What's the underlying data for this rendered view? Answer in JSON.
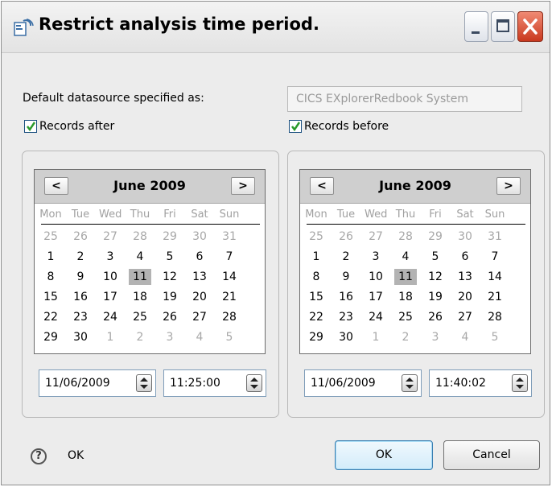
{
  "window": {
    "title": "Restrict analysis time period.",
    "controls": [
      "minimize",
      "maximize",
      "close"
    ]
  },
  "datasource": {
    "label": "Default datasource specified as:",
    "value": "CICS EXplorerRedbook System"
  },
  "records_after": {
    "label": "Records after",
    "checked": true,
    "calendar": {
      "month_label": "June 2009",
      "prev": "<",
      "next": ">",
      "weekdays": [
        "Mon",
        "Tue",
        "Wed",
        "Thu",
        "Fri",
        "Sat",
        "Sun"
      ],
      "weeks": [
        [
          "25",
          "26",
          "27",
          "28",
          "29",
          "30",
          "31"
        ],
        [
          "1",
          "2",
          "3",
          "4",
          "5",
          "6",
          "7"
        ],
        [
          "8",
          "9",
          "10",
          "11",
          "12",
          "13",
          "14"
        ],
        [
          "15",
          "16",
          "17",
          "18",
          "19",
          "20",
          "21"
        ],
        [
          "22",
          "23",
          "24",
          "25",
          "26",
          "27",
          "28"
        ],
        [
          "29",
          "30",
          "1",
          "2",
          "3",
          "4",
          "5"
        ]
      ],
      "selected_day": "11"
    },
    "date": "11/06/2009",
    "time": "11:25:00"
  },
  "records_before": {
    "label": "Records before",
    "checked": true,
    "calendar": {
      "month_label": "June 2009",
      "prev": "<",
      "next": ">",
      "weekdays": [
        "Mon",
        "Tue",
        "Wed",
        "Thu",
        "Fri",
        "Sat",
        "Sun"
      ],
      "weeks": [
        [
          "25",
          "26",
          "27",
          "28",
          "29",
          "30",
          "31"
        ],
        [
          "1",
          "2",
          "3",
          "4",
          "5",
          "6",
          "7"
        ],
        [
          "8",
          "9",
          "10",
          "11",
          "12",
          "13",
          "14"
        ],
        [
          "15",
          "16",
          "17",
          "18",
          "19",
          "20",
          "21"
        ],
        [
          "22",
          "23",
          "24",
          "25",
          "26",
          "27",
          "28"
        ],
        [
          "29",
          "30",
          "1",
          "2",
          "3",
          "4",
          "5"
        ]
      ],
      "selected_day": "11"
    },
    "date": "11/06/2009",
    "time": "11:40:02"
  },
  "footer": {
    "help_icon": "help-icon",
    "status_text": "OK",
    "ok_label": "OK",
    "cancel_label": "Cancel"
  },
  "colors": {
    "selected_day_bg": "#b3b3b3",
    "close_button": "#c9391f",
    "default_button_border": "#3c7fb1"
  }
}
